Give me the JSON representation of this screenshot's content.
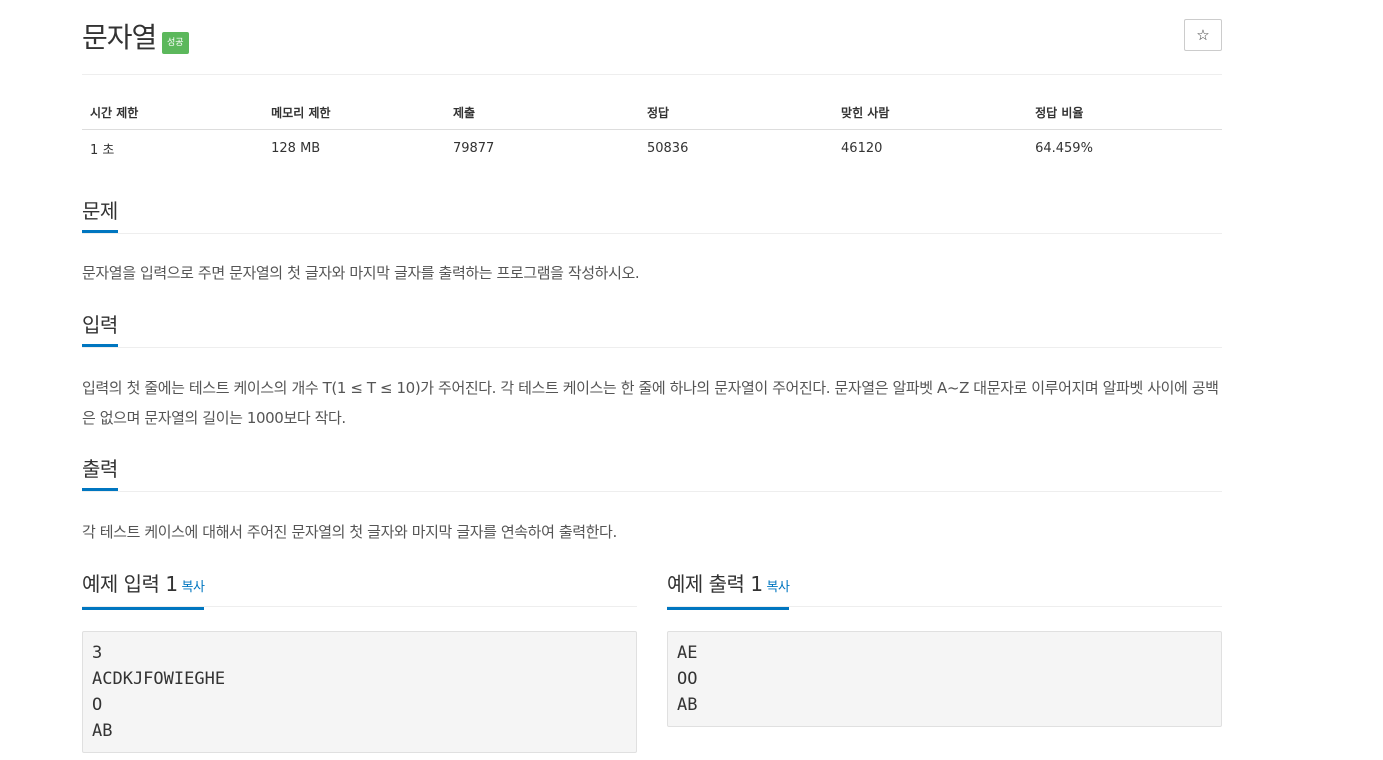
{
  "problem": {
    "title": "문자열",
    "badge": "성공",
    "star_icon": "☆"
  },
  "info_table": {
    "headers": [
      "시간 제한",
      "메모리 제한",
      "제출",
      "정답",
      "맞힌 사람",
      "정답 비율"
    ],
    "values": [
      "1 초",
      "128 MB",
      "79877",
      "50836",
      "46120",
      "64.459%"
    ]
  },
  "sections": {
    "problem": {
      "title": "문제",
      "text": "문자열을 입력으로 주면 문자열의 첫 글자와 마지막 글자를 출력하는 프로그램을 작성하시오."
    },
    "input": {
      "title": "입력",
      "text": "입력의 첫 줄에는 테스트 케이스의 개수 T(1 ≤ T ≤ 10)가 주어진다. 각 테스트 케이스는 한 줄에 하나의 문자열이 주어진다. 문자열은 알파벳 A~Z 대문자로 이루어지며 알파벳 사이에 공백은 없으며 문자열의 길이는 1000보다 작다."
    },
    "output": {
      "title": "출력",
      "text": "각 테스트 케이스에 대해서 주어진 문자열의 첫 글자와 마지막 글자를 연속하여 출력한다."
    }
  },
  "samples": {
    "input": {
      "title": "예제 입력 1",
      "copy_label": "복사",
      "content": "3\nACDKJFOWIEGHE\nO\nAB"
    },
    "output": {
      "title": "예제 출력 1",
      "copy_label": "복사",
      "content": "AE\nOO\nAB"
    }
  },
  "colors": {
    "accent": "#0076c0",
    "success": "#5cb85c"
  }
}
